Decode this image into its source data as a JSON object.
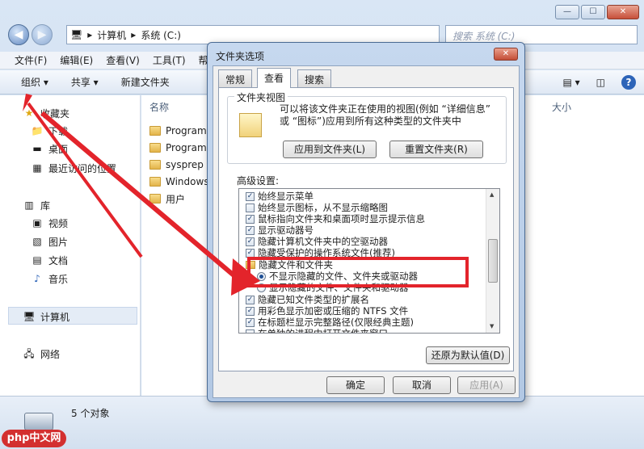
{
  "explorer": {
    "address": {
      "crumbs": [
        "计算机",
        "系统 (C:)"
      ],
      "separator": "▸"
    },
    "search_placeholder": "搜索 系统 (C:)",
    "menu": [
      "文件(F)",
      "编辑(E)",
      "查看(V)",
      "工具(T)",
      "帮助"
    ],
    "commands": [
      "组织 ▾",
      "共享 ▾",
      "新建文件夹"
    ],
    "sidebar": {
      "favorites": "收藏夹",
      "fav_items": [
        "下载",
        "桌面",
        "最近访问的位置"
      ],
      "libraries": "库",
      "lib_items": [
        "视频",
        "图片",
        "文档",
        "音乐"
      ],
      "computer": "计算机",
      "network": "网络"
    },
    "columns": {
      "name": "名称",
      "size": "大小"
    },
    "files": [
      "Program",
      "Program",
      "sysprep",
      "Windows",
      "用户"
    ],
    "status": "5 个对象"
  },
  "dialog": {
    "title": "文件夹选项",
    "tabs": [
      "常规",
      "查看",
      "搜索"
    ],
    "active_tab": "查看",
    "folder_views": {
      "title": "文件夹视图",
      "description": "可以将该文件夹正在使用的视图(例如 “详细信息” 或 “图标”)应用到所有这种类型的文件夹中",
      "apply_button": "应用到文件夹(L)",
      "reset_button": "重置文件夹(R)"
    },
    "advanced_label": "高级设置:",
    "settings": [
      {
        "type": "check",
        "checked": true,
        "text": "始终显示菜单"
      },
      {
        "type": "check",
        "checked": false,
        "text": "始终显示图标，从不显示缩略图"
      },
      {
        "type": "check",
        "checked": true,
        "text": "鼠标指向文件夹和桌面项时显示提示信息"
      },
      {
        "type": "check",
        "checked": true,
        "text": "显示驱动器号"
      },
      {
        "type": "check",
        "checked": true,
        "text": "隐藏计算机文件夹中的空驱动器"
      },
      {
        "type": "check",
        "checked": true,
        "text": "隐藏受保护的操作系统文件(推荐)"
      },
      {
        "type": "folder",
        "text": "隐藏文件和文件夹"
      },
      {
        "type": "radio",
        "checked": true,
        "text": "不显示隐藏的文件、文件夹或驱动器"
      },
      {
        "type": "radio",
        "checked": false,
        "text": "显示隐藏的文件、文件夹和驱动器"
      },
      {
        "type": "check",
        "checked": true,
        "text": "隐藏已知文件类型的扩展名"
      },
      {
        "type": "check",
        "checked": true,
        "text": "用彩色显示加密或压缩的 NTFS 文件"
      },
      {
        "type": "check",
        "checked": true,
        "text": "在标题栏显示完整路径(仅限经典主题)"
      },
      {
        "type": "check",
        "checked": false,
        "text": "在单独的进程中打开文件夹窗口"
      }
    ],
    "restore_button": "还原为默认值(D)",
    "ok_button": "确定",
    "cancel_button": "取消",
    "apply_button": "应用(A)"
  },
  "watermark": "php中文网",
  "colors": {
    "highlight": "#e3242b",
    "accent": "#1e4f95"
  }
}
